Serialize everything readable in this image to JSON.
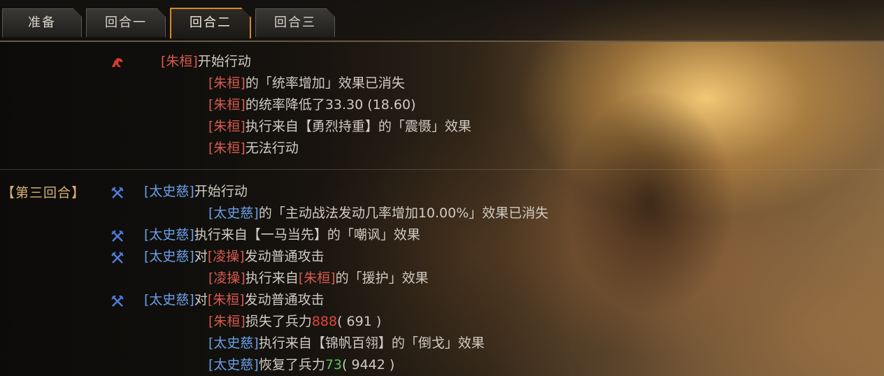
{
  "tabs": [
    {
      "label": "准备",
      "active": false
    },
    {
      "label": "回合一",
      "active": false
    },
    {
      "label": "回合二",
      "active": true
    },
    {
      "label": "回合三",
      "active": false
    }
  ],
  "colors": {
    "accent": "#d98a2a",
    "red_general": "#d85a4e",
    "blue_general": "#6a9fe8",
    "damage": "#e0453c",
    "heal": "#56c65c"
  },
  "round_label": "【第三回合】",
  "log": {
    "l1": {
      "name": "[朱桓]",
      "text": "开始行动"
    },
    "l2": {
      "name": "[朱桓]",
      "text": "的「统率增加」效果已消失"
    },
    "l3": {
      "name": "[朱桓]",
      "text": "的统率降低了33.30 (18.60)"
    },
    "l4": {
      "name": "[朱桓]",
      "text": "执行来自【勇烈持重】的「震慑」效果"
    },
    "l5": {
      "name": "[朱桓]",
      "text": "无法行动"
    },
    "l6": {
      "name": "[太史慈]",
      "text": "开始行动"
    },
    "l7": {
      "name": "[太史慈]",
      "text": "的「主动战法发动几率增加10.00%」效果已消失"
    },
    "l8": {
      "name": "[太史慈]",
      "text": "执行来自【一马当先】的「嘲讽」效果"
    },
    "l9": {
      "name": "[太史慈]",
      "mid": "对",
      "target": "[凌操]",
      "text": "发动普通攻击"
    },
    "l10": {
      "name": "[凌操]",
      "mid": "执行来自",
      "src": "[朱桓]",
      "text": "的「援护」效果"
    },
    "l11": {
      "name": "[太史慈]",
      "mid": "对",
      "target": "[朱桓]",
      "text": "发动普通攻击"
    },
    "l12": {
      "name": "[朱桓]",
      "text": "损失了兵力",
      "value": "888",
      "rest": "( 691 )"
    },
    "l13": {
      "name": "[太史慈]",
      "text": "执行来自【锦帆百翎】的「倒戈」效果"
    },
    "l14": {
      "name": "[太史慈]",
      "text": "恢复了兵力",
      "value": "73",
      "rest": "( 9442 )"
    }
  },
  "icons": {
    "red_action": "red-horse-icon",
    "blue_action": "crossed-swords-icon"
  }
}
